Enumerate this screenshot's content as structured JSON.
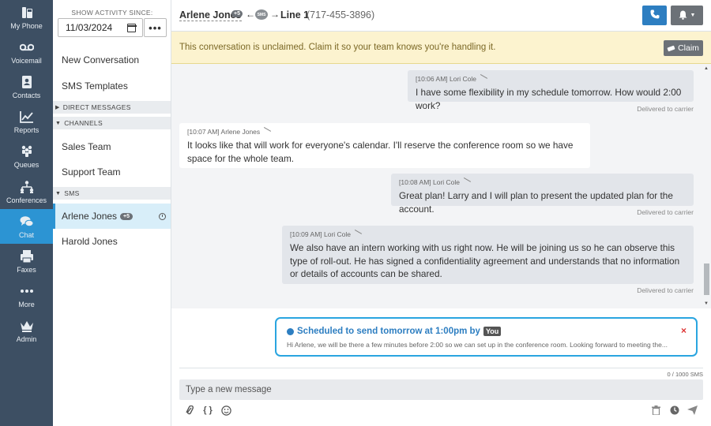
{
  "rail": {
    "items": [
      {
        "label": "My Phone",
        "icon": "phone-handset-icon"
      },
      {
        "label": "Voicemail",
        "icon": "voicemail-icon"
      },
      {
        "label": "Contacts",
        "icon": "address-book-icon"
      },
      {
        "label": "Reports",
        "icon": "line-chart-icon"
      },
      {
        "label": "Queues",
        "icon": "people-group-icon"
      },
      {
        "label": "Conferences",
        "icon": "sitemap-icon"
      },
      {
        "label": "Chat",
        "icon": "chat-bubbles-icon",
        "active": true
      },
      {
        "label": "Faxes",
        "icon": "fax-icon"
      },
      {
        "label": "More",
        "icon": "ellipsis-icon"
      },
      {
        "label": "Admin",
        "icon": "crown-icon"
      }
    ]
  },
  "sidebar": {
    "since_label": "SHOW ACTIVITY SINCE:",
    "since_date": "11/03/2024",
    "dots": "•••",
    "new_conversation": "New Conversation",
    "sms_templates": "SMS Templates",
    "direct_messages": "DIRECT MESSAGES",
    "channels": "CHANNELS",
    "channel_items": [
      "Sales Team",
      "Support Team"
    ],
    "sms": "SMS",
    "sms_items": [
      {
        "name": "Arlene Jones",
        "badge": "+5"
      },
      {
        "name": "Harold Jones"
      }
    ]
  },
  "header": {
    "contact": "Arlene Jones",
    "badge": "+5",
    "arrow_left": "←",
    "arrow_right": "→",
    "sms_icon_text": "SMS",
    "line": "Line 1",
    "number": "(717-455-3896)"
  },
  "banner": {
    "text": "This conversation is unclaimed. Claim it so your team knows you're handling it.",
    "claim": "Claim"
  },
  "messages": [
    {
      "direction": "out",
      "meta": "[10:06 AM] Lori Cole",
      "text": "I have some flexibility in my schedule tomorrow. How would 2:00 work?",
      "status": "Delivered to carrier"
    },
    {
      "direction": "in",
      "meta": "[10:07 AM] Arlene Jones",
      "text": "It looks like that will work for everyone's calendar. I'll reserve the conference room so we have space for the whole team."
    },
    {
      "direction": "out",
      "meta": "[10:08 AM] Lori Cole",
      "text": "Great plan! Larry and I will plan to present the updated plan for the account.",
      "status": "Delivered to carrier"
    },
    {
      "direction": "out",
      "meta": "[10:09 AM] Lori Cole",
      "text": "We also have an intern working with us right now. He will be joining us so he can observe this type of roll-out. He has signed a confidentiality agreement and understands that no information or details of accounts can be shared.",
      "status": "Delivered to carrier"
    }
  ],
  "scheduled": {
    "title": "Scheduled to send tomorrow at 1:00pm by",
    "by": "You",
    "preview": "Hi Arlene, we will be there a few minutes before 2:00 so we can set up in the conference room. Looking forward to meeting the...",
    "close": "×"
  },
  "composer": {
    "counter": "0 / 1000 SMS",
    "placeholder": "Type a new message",
    "braces": "{ }"
  },
  "colors": {
    "rail_bg": "#3d4f63",
    "accent": "#2c94d3",
    "banner_bg": "#fcf3cf",
    "scheduled_border": "#2aa5e0"
  }
}
